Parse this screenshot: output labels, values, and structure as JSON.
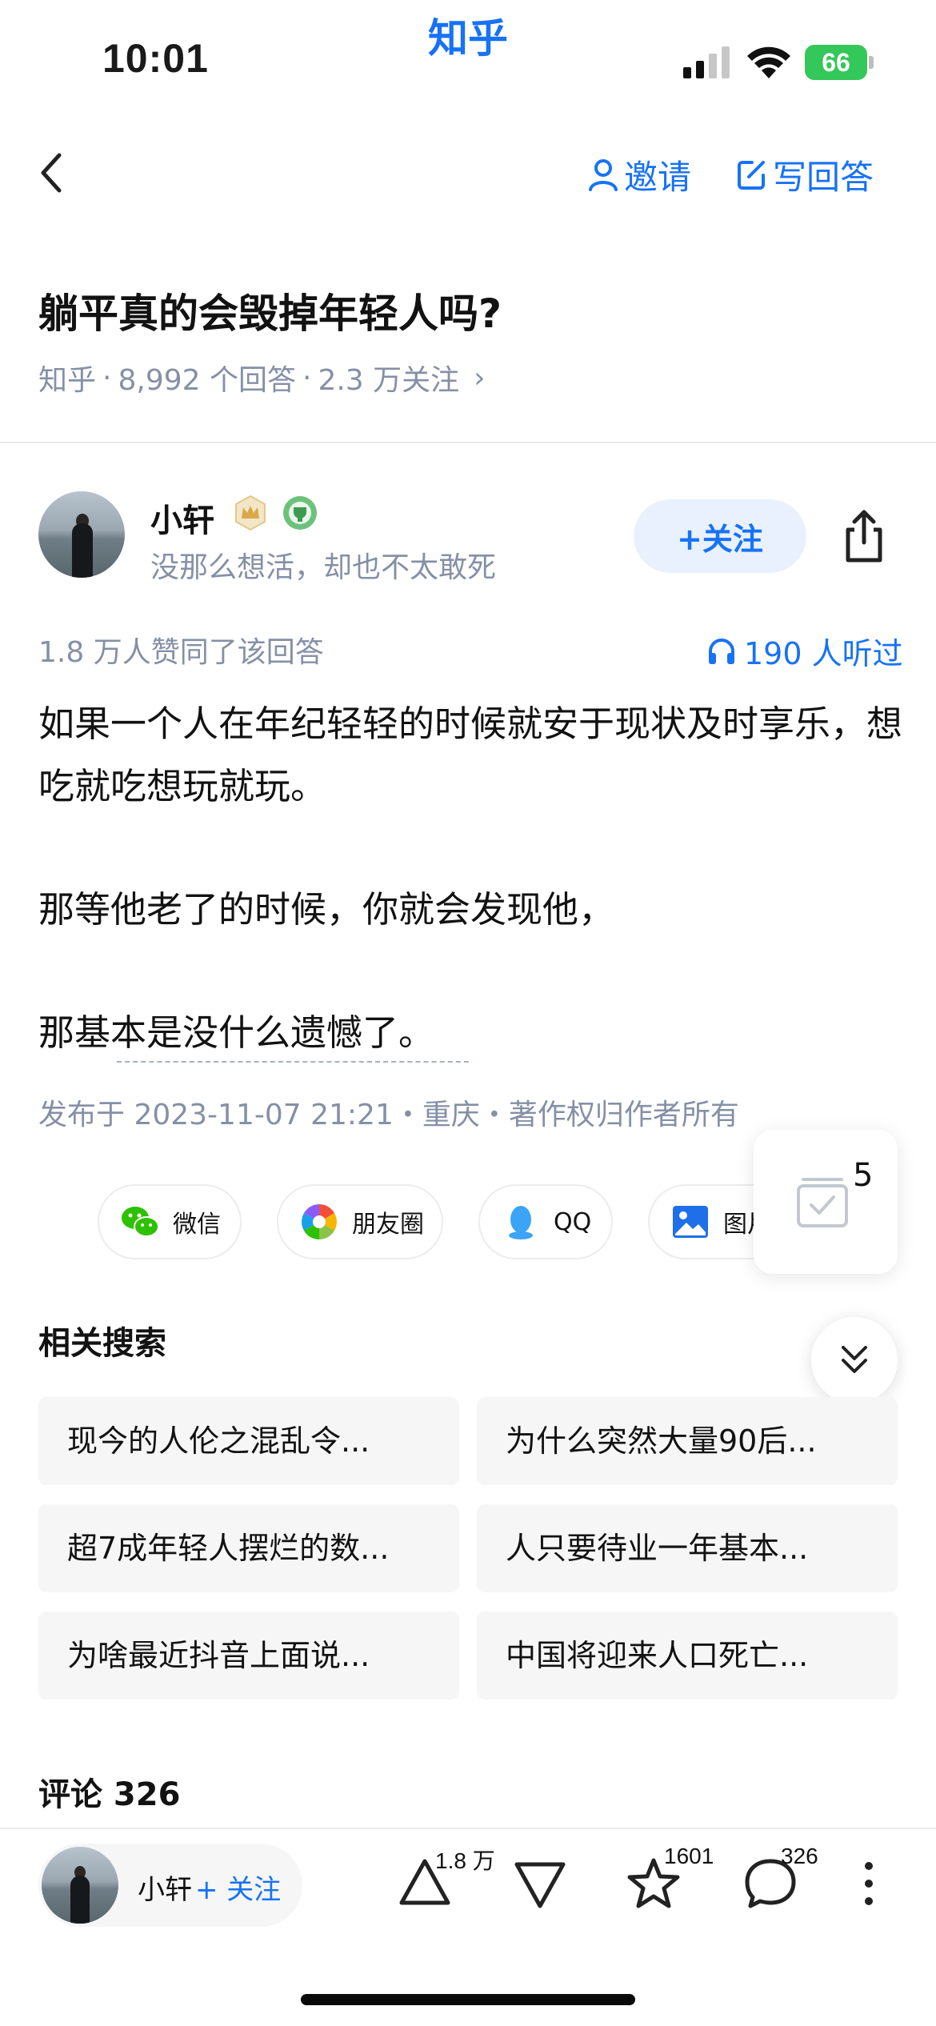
{
  "status_bar": {
    "time": "10:01",
    "app_label": "知乎",
    "battery": "66"
  },
  "nav": {
    "invite_label": "邀请",
    "write_label": "写回答"
  },
  "question": {
    "title": "躺平真的会毁掉年轻人吗?",
    "meta_source": "知乎",
    "meta_answers": "8,992 个回答",
    "meta_follows": "2.3 万关注",
    "meta_arrow": "›"
  },
  "author": {
    "name": "小轩",
    "bio": "没那么想活，却也不太敢死",
    "follow_label": "+关注"
  },
  "answer": {
    "votes_text": "1.8 万人赞同了该回答",
    "listen_text": "190 人听过",
    "paragraphs": [
      "如果一个人在年纪轻轻的时候就安于现状及时享乐，想吃就吃想玩就玩。",
      "那等他老了的时候，你就会发现他，",
      "那基本是没什么遗憾了。"
    ],
    "publish_text": "发布于 2023-11-07 21:21・重庆・著作权归作者所有"
  },
  "share": {
    "wechat": "微信",
    "moments": "朋友圈",
    "qq": "QQ",
    "image": "图片"
  },
  "float_card": {
    "count": "5"
  },
  "related": {
    "title": "相关搜索",
    "items": [
      "现今的人伦之混乱令...",
      "为什么突然大量90后...",
      "超7成年轻人摆烂的数...",
      "人只要待业一年基本...",
      "为啥最近抖音上面说...",
      "中国将迎来人口死亡..."
    ]
  },
  "comments": {
    "title": "评论 326"
  },
  "bottom_bar": {
    "author_name": "小轩",
    "follow_label": "+ 关注",
    "upvote_count": "1.8 万",
    "favorite_count": "1601",
    "comment_count": "326"
  },
  "colors": {
    "brand_blue": "#1772f6",
    "meta_gray": "#8590a6",
    "chip_bg": "#f6f6f6"
  }
}
